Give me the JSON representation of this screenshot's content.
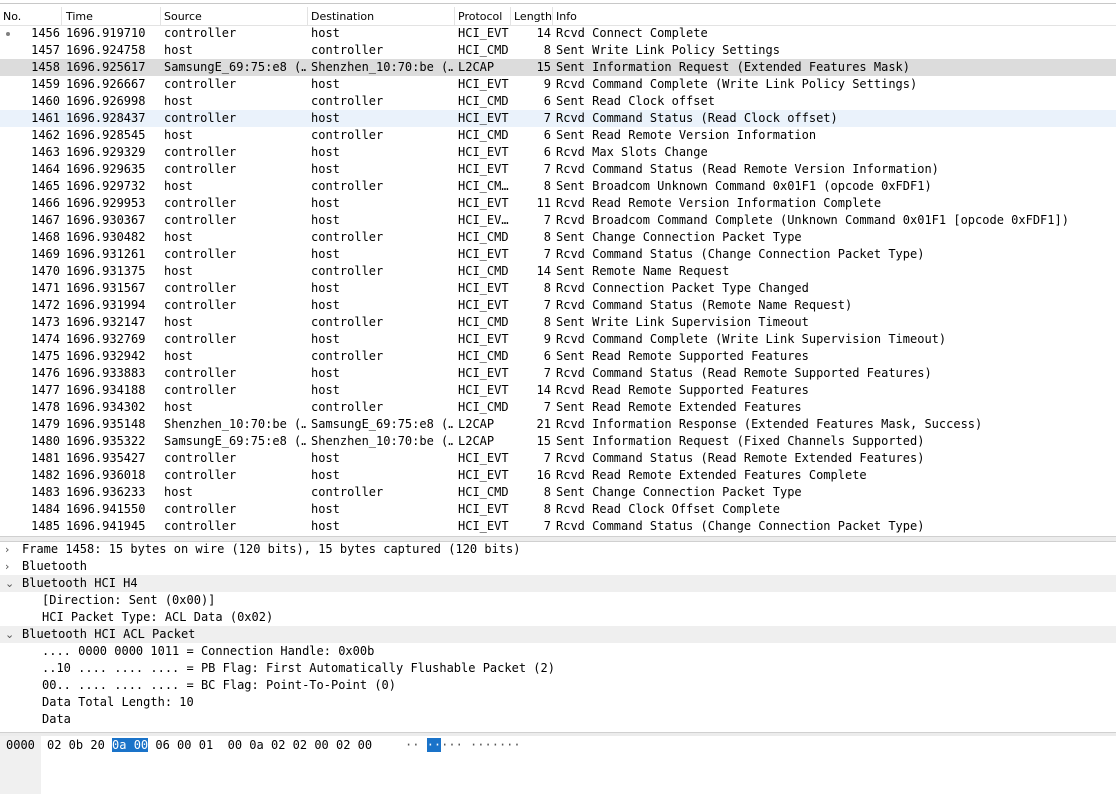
{
  "columns": [
    "No.",
    "Time",
    "Source",
    "Destination",
    "Protocol",
    "Length",
    "Info"
  ],
  "packets": [
    {
      "no": "1456",
      "time": "1696.919710",
      "src": "controller",
      "dst": "host",
      "proto": "HCI_EVT",
      "len": "14",
      "info": "Rcvd Connect Complete",
      "mark": true
    },
    {
      "no": "1457",
      "time": "1696.924758",
      "src": "host",
      "dst": "controller",
      "proto": "HCI_CMD",
      "len": "8",
      "info": "Sent Write Link Policy Settings"
    },
    {
      "no": "1458",
      "time": "1696.925617",
      "src": "SamsungE_69:75:e8 (…",
      "dst": "Shenzhen_10:70:be (…",
      "proto": "L2CAP",
      "len": "15",
      "info": "Sent Information Request (Extended Features Mask)",
      "state": "sel"
    },
    {
      "no": "1459",
      "time": "1696.926667",
      "src": "controller",
      "dst": "host",
      "proto": "HCI_EVT",
      "len": "9",
      "info": "Rcvd Command Complete (Write Link Policy Settings)"
    },
    {
      "no": "1460",
      "time": "1696.926998",
      "src": "host",
      "dst": "controller",
      "proto": "HCI_CMD",
      "len": "6",
      "info": "Sent Read Clock offset"
    },
    {
      "no": "1461",
      "time": "1696.928437",
      "src": "controller",
      "dst": "host",
      "proto": "HCI_EVT",
      "len": "7",
      "info": "Rcvd Command Status (Read Clock offset)",
      "state": "hl"
    },
    {
      "no": "1462",
      "time": "1696.928545",
      "src": "host",
      "dst": "controller",
      "proto": "HCI_CMD",
      "len": "6",
      "info": "Sent Read Remote Version Information"
    },
    {
      "no": "1463",
      "time": "1696.929329",
      "src": "controller",
      "dst": "host",
      "proto": "HCI_EVT",
      "len": "6",
      "info": "Rcvd Max Slots Change"
    },
    {
      "no": "1464",
      "time": "1696.929635",
      "src": "controller",
      "dst": "host",
      "proto": "HCI_EVT",
      "len": "7",
      "info": "Rcvd Command Status (Read Remote Version Information)"
    },
    {
      "no": "1465",
      "time": "1696.929732",
      "src": "host",
      "dst": "controller",
      "proto": "HCI_CM…",
      "len": "8",
      "info": "Sent Broadcom Unknown Command 0x01F1 (opcode 0xFDF1)"
    },
    {
      "no": "1466",
      "time": "1696.929953",
      "src": "controller",
      "dst": "host",
      "proto": "HCI_EVT",
      "len": "11",
      "info": "Rcvd Read Remote Version Information Complete"
    },
    {
      "no": "1467",
      "time": "1696.930367",
      "src": "controller",
      "dst": "host",
      "proto": "HCI_EV…",
      "len": "7",
      "info": "Rcvd Broadcom Command Complete (Unknown Command 0x01F1 [opcode 0xFDF1])"
    },
    {
      "no": "1468",
      "time": "1696.930482",
      "src": "host",
      "dst": "controller",
      "proto": "HCI_CMD",
      "len": "8",
      "info": "Sent Change Connection Packet Type"
    },
    {
      "no": "1469",
      "time": "1696.931261",
      "src": "controller",
      "dst": "host",
      "proto": "HCI_EVT",
      "len": "7",
      "info": "Rcvd Command Status (Change Connection Packet Type)"
    },
    {
      "no": "1470",
      "time": "1696.931375",
      "src": "host",
      "dst": "controller",
      "proto": "HCI_CMD",
      "len": "14",
      "info": "Sent Remote Name Request"
    },
    {
      "no": "1471",
      "time": "1696.931567",
      "src": "controller",
      "dst": "host",
      "proto": "HCI_EVT",
      "len": "8",
      "info": "Rcvd Connection Packet Type Changed"
    },
    {
      "no": "1472",
      "time": "1696.931994",
      "src": "controller",
      "dst": "host",
      "proto": "HCI_EVT",
      "len": "7",
      "info": "Rcvd Command Status (Remote Name Request)"
    },
    {
      "no": "1473",
      "time": "1696.932147",
      "src": "host",
      "dst": "controller",
      "proto": "HCI_CMD",
      "len": "8",
      "info": "Sent Write Link Supervision Timeout"
    },
    {
      "no": "1474",
      "time": "1696.932769",
      "src": "controller",
      "dst": "host",
      "proto": "HCI_EVT",
      "len": "9",
      "info": "Rcvd Command Complete (Write Link Supervision Timeout)"
    },
    {
      "no": "1475",
      "time": "1696.932942",
      "src": "host",
      "dst": "controller",
      "proto": "HCI_CMD",
      "len": "6",
      "info": "Sent Read Remote Supported Features"
    },
    {
      "no": "1476",
      "time": "1696.933883",
      "src": "controller",
      "dst": "host",
      "proto": "HCI_EVT",
      "len": "7",
      "info": "Rcvd Command Status (Read Remote Supported Features)"
    },
    {
      "no": "1477",
      "time": "1696.934188",
      "src": "controller",
      "dst": "host",
      "proto": "HCI_EVT",
      "len": "14",
      "info": "Rcvd Read Remote Supported Features"
    },
    {
      "no": "1478",
      "time": "1696.934302",
      "src": "host",
      "dst": "controller",
      "proto": "HCI_CMD",
      "len": "7",
      "info": "Sent Read Remote Extended Features"
    },
    {
      "no": "1479",
      "time": "1696.935148",
      "src": "Shenzhen_10:70:be (…",
      "dst": "SamsungE_69:75:e8 (…",
      "proto": "L2CAP",
      "len": "21",
      "info": "Rcvd Information Response (Extended Features Mask, Success)"
    },
    {
      "no": "1480",
      "time": "1696.935322",
      "src": "SamsungE_69:75:e8 (…",
      "dst": "Shenzhen_10:70:be (…",
      "proto": "L2CAP",
      "len": "15",
      "info": "Sent Information Request (Fixed Channels Supported)"
    },
    {
      "no": "1481",
      "time": "1696.935427",
      "src": "controller",
      "dst": "host",
      "proto": "HCI_EVT",
      "len": "7",
      "info": "Rcvd Command Status (Read Remote Extended Features)"
    },
    {
      "no": "1482",
      "time": "1696.936018",
      "src": "controller",
      "dst": "host",
      "proto": "HCI_EVT",
      "len": "16",
      "info": "Rcvd Read Remote Extended Features Complete"
    },
    {
      "no": "1483",
      "time": "1696.936233",
      "src": "host",
      "dst": "controller",
      "proto": "HCI_CMD",
      "len": "8",
      "info": "Sent Change Connection Packet Type"
    },
    {
      "no": "1484",
      "time": "1696.941550",
      "src": "controller",
      "dst": "host",
      "proto": "HCI_EVT",
      "len": "8",
      "info": "Rcvd Read Clock Offset Complete"
    },
    {
      "no": "1485",
      "time": "1696.941945",
      "src": "controller",
      "dst": "host",
      "proto": "HCI_EVT",
      "len": "7",
      "info": "Rcvd Command Status (Change Connection Packet Type)"
    }
  ],
  "details": [
    {
      "text": "Frame 1458: 15 bytes on wire (120 bits), 15 bytes captured (120 bits)",
      "level": 0,
      "chevron": "›",
      "section": false
    },
    {
      "text": "Bluetooth",
      "level": 0,
      "chevron": "›",
      "section": false
    },
    {
      "text": "Bluetooth HCI H4",
      "level": 0,
      "chevron": "⌄",
      "section": true
    },
    {
      "text": "[Direction: Sent (0x00)]",
      "level": 1,
      "chevron": "",
      "section": false
    },
    {
      "text": "HCI Packet Type: ACL Data (0x02)",
      "level": 1,
      "chevron": "",
      "section": false
    },
    {
      "text": "Bluetooth HCI ACL Packet",
      "level": 0,
      "chevron": "⌄",
      "section": true
    },
    {
      "text": ".... 0000 0000 1011 = Connection Handle: 0x00b",
      "level": 1,
      "chevron": "",
      "section": false
    },
    {
      "text": "..10 .... .... .... = PB Flag: First Automatically Flushable Packet (2)",
      "level": 1,
      "chevron": "",
      "section": false
    },
    {
      "text": "00.. .... .... .... = BC Flag: Point-To-Point (0)",
      "level": 1,
      "chevron": "",
      "section": false
    },
    {
      "text": "Data Total Length: 10",
      "level": 1,
      "chevron": "",
      "section": false
    },
    {
      "text": "Data",
      "level": 1,
      "chevron": "",
      "section": false
    }
  ],
  "hex": {
    "offset": "0000",
    "bytes_before": "02 0b 20 ",
    "bytes_selected": "0a 00",
    "bytes_after": " 06 00 01  00 0a 02 02 00 02 00",
    "ascii_before": "·· ",
    "ascii_selected": "··",
    "ascii_after": "··· ·······"
  }
}
